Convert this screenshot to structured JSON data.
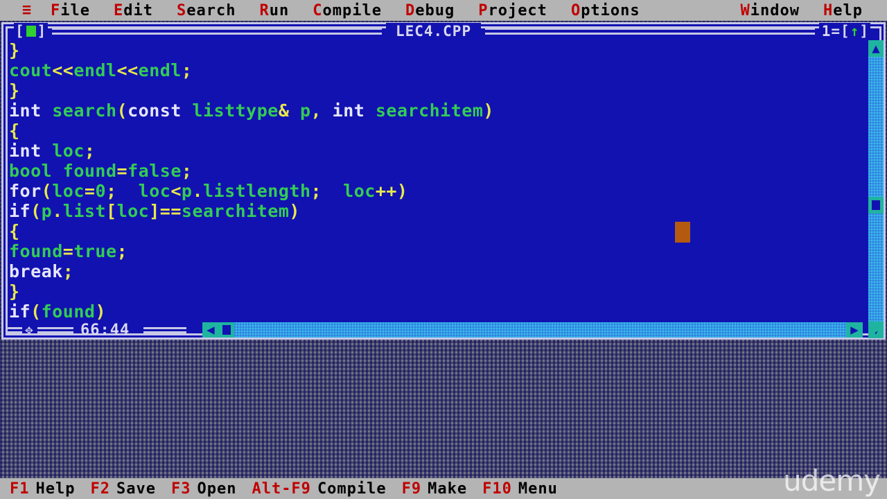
{
  "menubar": {
    "system_icon": "hamburger-icon",
    "system_glyph": "≡",
    "items": [
      {
        "hot": "F",
        "rest": "ile",
        "name": "file"
      },
      {
        "hot": "E",
        "rest": "dit",
        "name": "edit"
      },
      {
        "hot": "S",
        "rest": "earch",
        "name": "search"
      },
      {
        "hot": "R",
        "rest": "un",
        "name": "run"
      },
      {
        "hot": "C",
        "rest": "ompile",
        "name": "compile"
      },
      {
        "hot": "D",
        "rest": "ebug",
        "name": "debug"
      },
      {
        "hot": "P",
        "rest": "roject",
        "name": "project"
      },
      {
        "hot": "O",
        "rest": "ptions",
        "name": "options"
      }
    ],
    "right_items": [
      {
        "hot": "W",
        "rest": "indow",
        "name": "window"
      },
      {
        "hot": "H",
        "rest": "elp",
        "name": "help"
      }
    ]
  },
  "editor": {
    "title": "LEC4.CPP",
    "window_number": "1",
    "close_box": "[■]",
    "zoom_box_arrow": "↑",
    "status_line_col": "66:44",
    "cursor_glyph": "▬",
    "scroll": {
      "up_arrow": "▲",
      "down_arrow": "▼",
      "left_arrow": "◀",
      "right_arrow": "▶"
    },
    "grip_glyph": "✥",
    "code_lines": [
      [
        {
          "t": "}",
          "c": "op"
        }
      ],
      [
        {
          "t": "cout",
          "c": "id"
        },
        {
          "t": "<<",
          "c": "op"
        },
        {
          "t": "endl",
          "c": "id"
        },
        {
          "t": "<<",
          "c": "op"
        },
        {
          "t": "endl",
          "c": "id"
        },
        {
          "t": ";",
          "c": "op"
        }
      ],
      [
        {
          "t": "}",
          "c": "op"
        }
      ],
      [
        {
          "t": "int",
          "c": "kw"
        },
        {
          "t": " ",
          "c": "id"
        },
        {
          "t": "search",
          "c": "id"
        },
        {
          "t": "(",
          "c": "op"
        },
        {
          "t": "const",
          "c": "kw"
        },
        {
          "t": " ",
          "c": "id"
        },
        {
          "t": "listtype",
          "c": "id"
        },
        {
          "t": "&",
          "c": "op"
        },
        {
          "t": " ",
          "c": "id"
        },
        {
          "t": "p",
          "c": "id"
        },
        {
          "t": ", ",
          "c": "op"
        },
        {
          "t": "int",
          "c": "kw"
        },
        {
          "t": " ",
          "c": "id"
        },
        {
          "t": "searchitem",
          "c": "id"
        },
        {
          "t": ")",
          "c": "op"
        }
      ],
      [
        {
          "t": "{",
          "c": "op"
        }
      ],
      [
        {
          "t": "int",
          "c": "kw"
        },
        {
          "t": " ",
          "c": "id"
        },
        {
          "t": "loc",
          "c": "id"
        },
        {
          "t": ";",
          "c": "op"
        }
      ],
      [
        {
          "t": "bool",
          "c": "id"
        },
        {
          "t": " ",
          "c": "id"
        },
        {
          "t": "found",
          "c": "id"
        },
        {
          "t": "=",
          "c": "op"
        },
        {
          "t": "false",
          "c": "id"
        },
        {
          "t": ";",
          "c": "op"
        }
      ],
      [
        {
          "t": "for",
          "c": "kw"
        },
        {
          "t": "(",
          "c": "op"
        },
        {
          "t": "loc",
          "c": "id"
        },
        {
          "t": "=",
          "c": "op"
        },
        {
          "t": "0",
          "c": "num"
        },
        {
          "t": ";  ",
          "c": "op"
        },
        {
          "t": "loc",
          "c": "id"
        },
        {
          "t": "<",
          "c": "op"
        },
        {
          "t": "p",
          "c": "id"
        },
        {
          "t": ".",
          "c": "op"
        },
        {
          "t": "listlength",
          "c": "id"
        },
        {
          "t": ";  ",
          "c": "op"
        },
        {
          "t": "loc",
          "c": "id"
        },
        {
          "t": "++)",
          "c": "op"
        }
      ],
      [
        {
          "t": "if",
          "c": "kw"
        },
        {
          "t": "(",
          "c": "op"
        },
        {
          "t": "p",
          "c": "id"
        },
        {
          "t": ".",
          "c": "op"
        },
        {
          "t": "list",
          "c": "id"
        },
        {
          "t": "[",
          "c": "op"
        },
        {
          "t": "loc",
          "c": "id"
        },
        {
          "t": "]==",
          "c": "op"
        },
        {
          "t": "searchitem",
          "c": "id"
        },
        {
          "t": ")",
          "c": "op"
        }
      ],
      [
        {
          "t": "{",
          "c": "op"
        }
      ],
      [
        {
          "t": "found",
          "c": "id"
        },
        {
          "t": "=",
          "c": "op"
        },
        {
          "t": "true",
          "c": "id"
        },
        {
          "t": ";",
          "c": "op"
        }
      ],
      [
        {
          "t": "break",
          "c": "kw"
        },
        {
          "t": ";",
          "c": "op"
        }
      ],
      [
        {
          "t": "}",
          "c": "op"
        }
      ],
      [
        {
          "t": "if",
          "c": "kw"
        },
        {
          "t": "(",
          "c": "op"
        },
        {
          "t": "found",
          "c": "id"
        },
        {
          "t": ")",
          "c": "op"
        }
      ]
    ]
  },
  "fnbar": {
    "items": [
      {
        "key": "F1",
        "label": "Help",
        "name": "help"
      },
      {
        "key": "F2",
        "label": "Save",
        "name": "save"
      },
      {
        "key": "F3",
        "label": "Open",
        "name": "open"
      },
      {
        "key": "Alt-F9",
        "label": "Compile",
        "name": "compile"
      },
      {
        "key": "F9",
        "label": "Make",
        "name": "make"
      },
      {
        "key": "F10",
        "label": "Menu",
        "name": "menu"
      }
    ]
  },
  "watermark": {
    "text": "udemy"
  },
  "colors": {
    "menu_bg": "#b4b4b4",
    "hotkey_red": "#c00000",
    "window_bg": "#1212b0",
    "frame": "#c8c8e8",
    "identifier_green": "#33cc55",
    "keyword_white": "#e6e6ff",
    "operator_yellow": "#e8e84c",
    "cursor_orange": "#b45a10",
    "scrollbar_teal": "#1fb4a0"
  }
}
